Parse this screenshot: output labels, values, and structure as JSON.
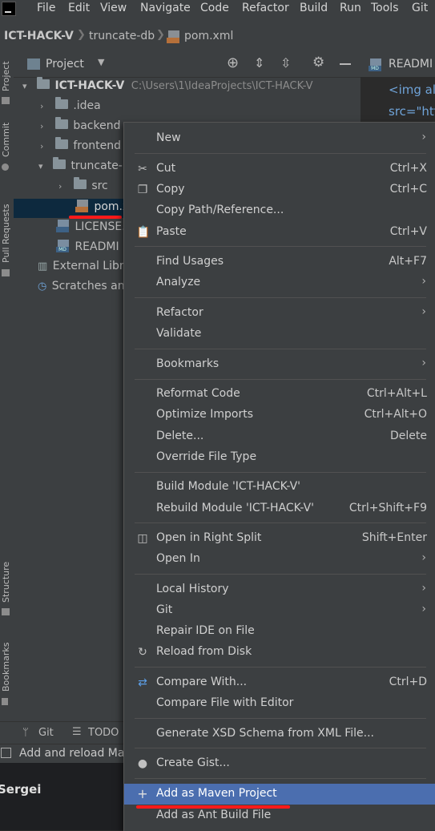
{
  "menubar": {
    "items": [
      "File",
      "Edit",
      "View",
      "Navigate",
      "Code",
      "Refactor",
      "Build",
      "Run",
      "Tools",
      "Git"
    ]
  },
  "navbar": {
    "project": "ICT-HACK-V",
    "module": "truncate-db",
    "file": "pom.xml"
  },
  "left_stripe": {
    "project": "Project",
    "commit": "Commit",
    "pull_requests": "Pull Requests",
    "structure": "Structure",
    "bookmarks": "Bookmarks"
  },
  "project_panel": {
    "title": "Project",
    "tree": [
      {
        "label": "ICT-HACK-V",
        "path": "C:\\Users\\1\\IdeaProjects\\ICT-HACK-V"
      },
      {
        "label": ".idea"
      },
      {
        "label": "backend"
      },
      {
        "label": "frontend"
      },
      {
        "label": "truncate-"
      },
      {
        "label": "src"
      },
      {
        "label": "pom.x"
      },
      {
        "label": "LICENSE."
      },
      {
        "label": "READMI"
      },
      {
        "label": "External Libr"
      },
      {
        "label": "Scratches an"
      }
    ]
  },
  "editor": {
    "tab": "READMI",
    "line1": "<img al",
    "line2": "src=\"htt"
  },
  "bottom_bar": {
    "git": "Git",
    "todo": "TODO"
  },
  "status_bar": {
    "text": "Add and reload Ma"
  },
  "dark_bottom": {
    "text": "Sergei"
  },
  "context_menu": {
    "new": "New",
    "cut": "Cut",
    "cut_sc": "Ctrl+X",
    "copy": "Copy",
    "copy_sc": "Ctrl+C",
    "copy_path": "Copy Path/Reference...",
    "paste": "Paste",
    "paste_sc": "Ctrl+V",
    "find_usages": "Find Usages",
    "find_usages_sc": "Alt+F7",
    "analyze": "Analyze",
    "refactor": "Refactor",
    "validate": "Validate",
    "bookmarks": "Bookmarks",
    "reformat": "Reformat Code",
    "reformat_sc": "Ctrl+Alt+L",
    "optimize": "Optimize Imports",
    "optimize_sc": "Ctrl+Alt+O",
    "delete": "Delete...",
    "delete_sc": "Delete",
    "override": "Override File Type",
    "build_module": "Build Module 'ICT-HACK-V'",
    "rebuild_module": "Rebuild Module 'ICT-HACK-V'",
    "rebuild_sc": "Ctrl+Shift+F9",
    "open_right": "Open in Right Split",
    "open_right_sc": "Shift+Enter",
    "open_in": "Open In",
    "local_history": "Local History",
    "git": "Git",
    "repair": "Repair IDE on File",
    "reload": "Reload from Disk",
    "compare_with": "Compare With...",
    "compare_with_sc": "Ctrl+D",
    "compare_editor": "Compare File with Editor",
    "generate_xsd": "Generate XSD Schema from XML File...",
    "create_gist": "Create Gist...",
    "add_maven": "Add as Maven Project",
    "add_ant": "Add as Ant Build File"
  },
  "colors": {
    "highlight": "#4b6eaf",
    "annotation_red": "#ff1a1a",
    "selected_row": "#0d293e"
  }
}
